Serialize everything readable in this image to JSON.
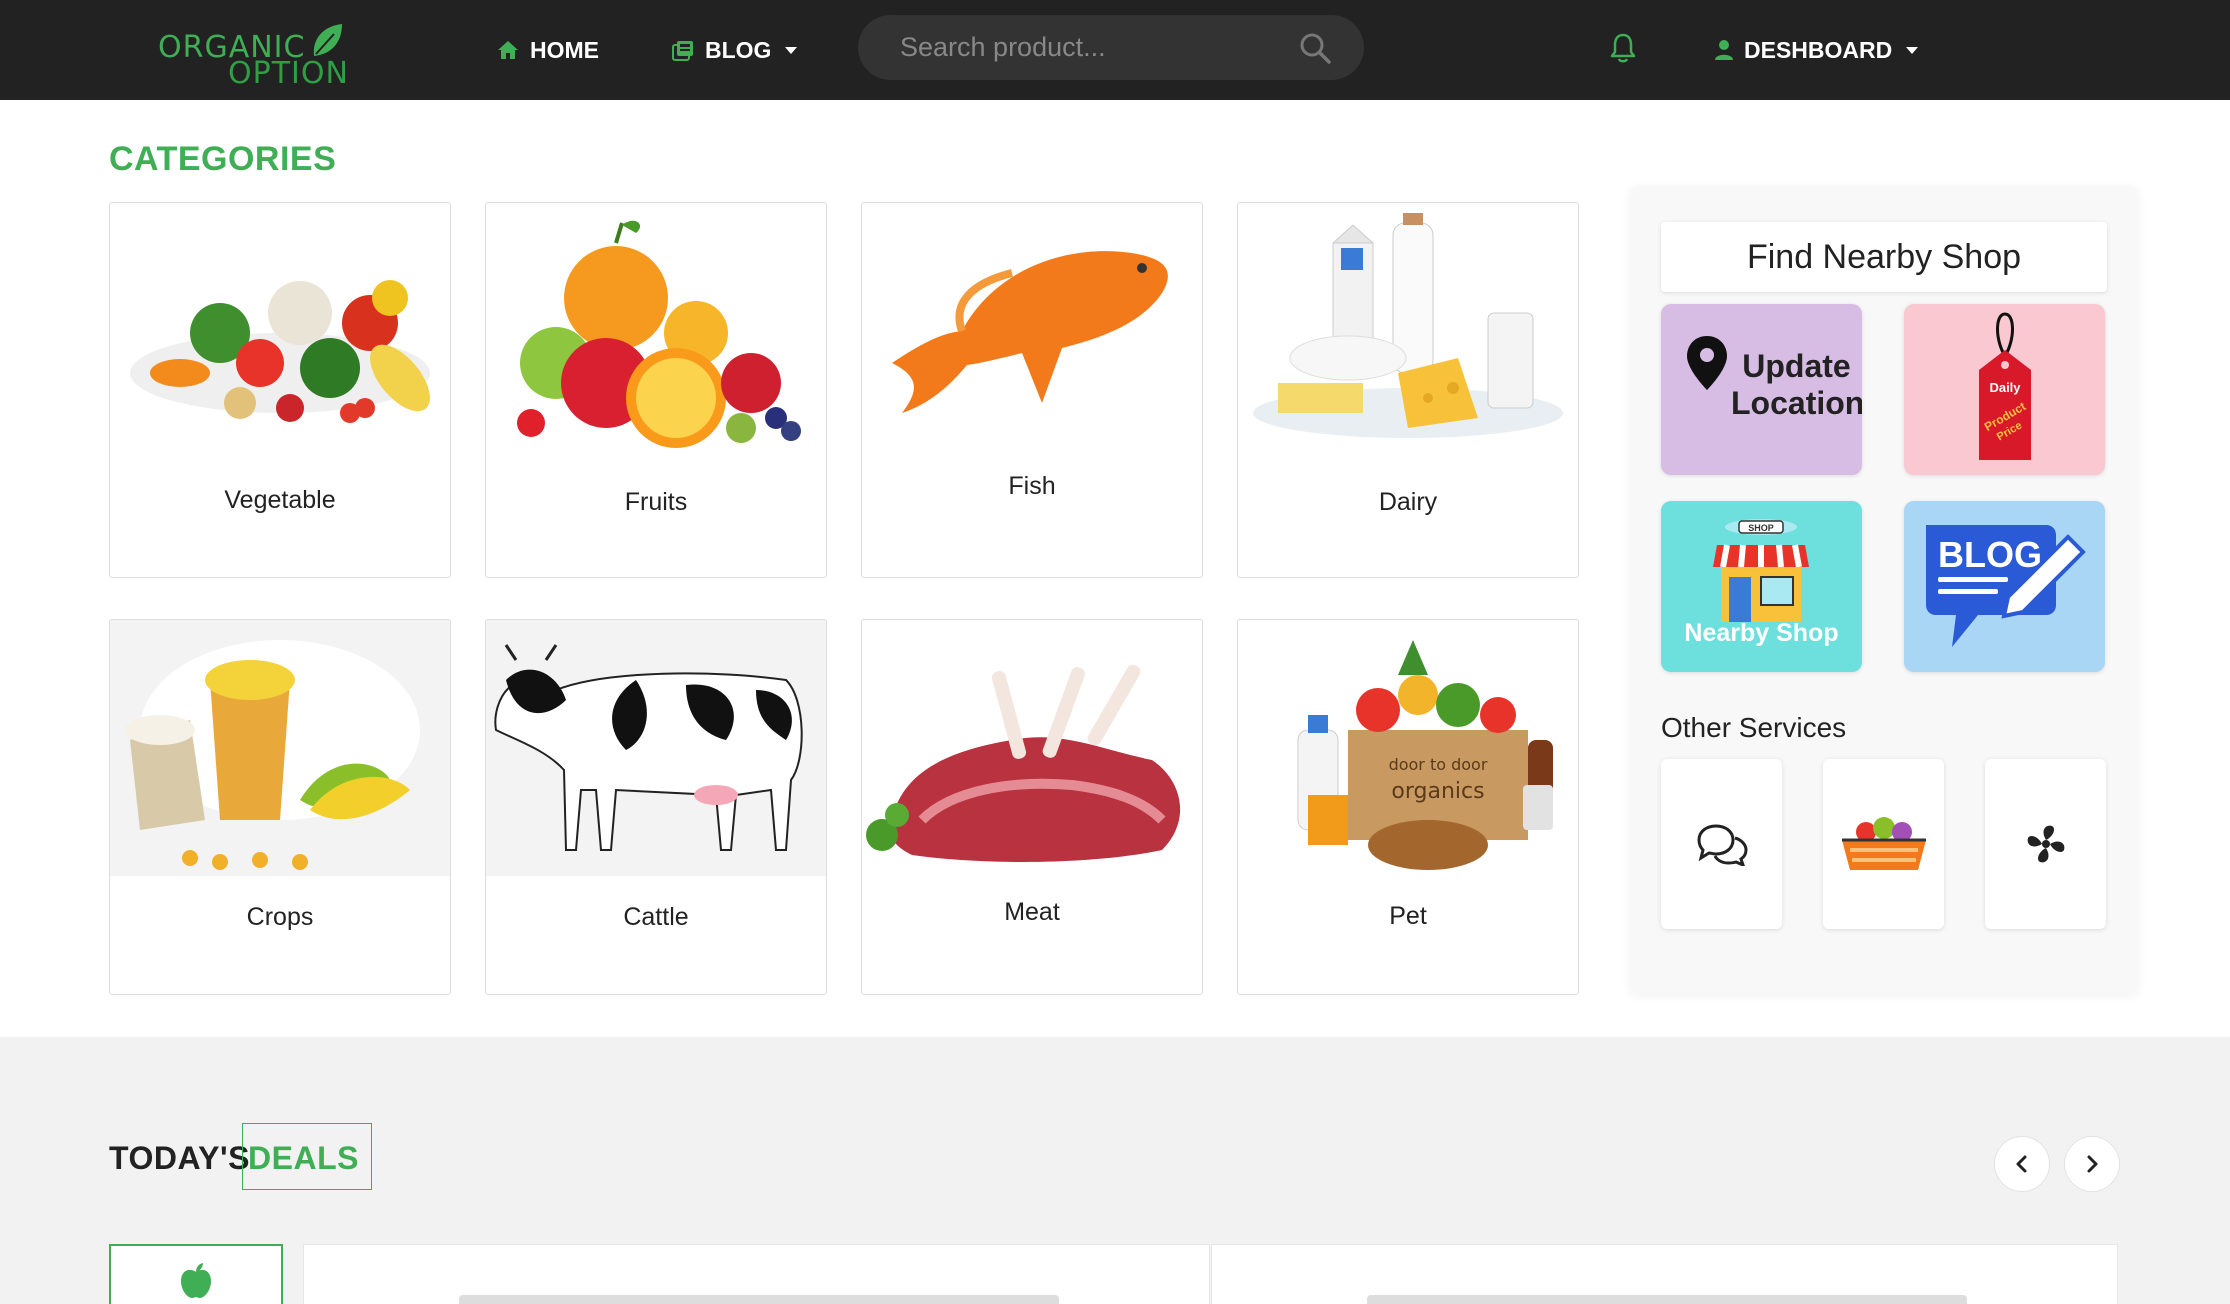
{
  "nav": {
    "logo_line1": "ORGANIC",
    "logo_line2": "OPTION",
    "home_label": "HOME",
    "blog_label": "BLOG",
    "search_placeholder": "Search product...",
    "dashboard_label": "DESHBOARD",
    "icons": [
      "home-icon",
      "blog-icon",
      "search-icon",
      "bell-icon",
      "user-icon"
    ]
  },
  "categories": {
    "title": "CATEGORIES",
    "items": [
      {
        "label": "Vegetable"
      },
      {
        "label": "Fruits"
      },
      {
        "label": "Fish"
      },
      {
        "label": "Dairy"
      },
      {
        "label": "Crops"
      },
      {
        "label": "Cattle"
      },
      {
        "label": "Meat"
      },
      {
        "label": "Pet"
      }
    ]
  },
  "sidebar": {
    "find_title": "Find Nearby Shop",
    "update_location": "Update Location",
    "daily_price_tag": [
      "Daily",
      "Product",
      "Price"
    ],
    "shop_sign": "SHOP",
    "nearby_shop": "Nearby Shop",
    "blog_tile": "BLOG",
    "door_organics": [
      "door to door",
      "organics"
    ],
    "other_services_title": "Other Services",
    "services": [
      "chat-icon",
      "basket-icon",
      "fan-icon"
    ]
  },
  "deals": {
    "title_dark": "TODAY'S",
    "title_green": "DEALS",
    "active_tab_icon": "apple-icon"
  },
  "colors": {
    "brand_green": "#3fae54",
    "navbar": "#222222",
    "search_bg": "#333333",
    "deals_bg": "#f2f2f2",
    "location_tile": "#d7bde4",
    "price_tile": "#f9c8d1",
    "shop_tile": "#6de0dd",
    "blog_tile": "#a9d6f5"
  }
}
